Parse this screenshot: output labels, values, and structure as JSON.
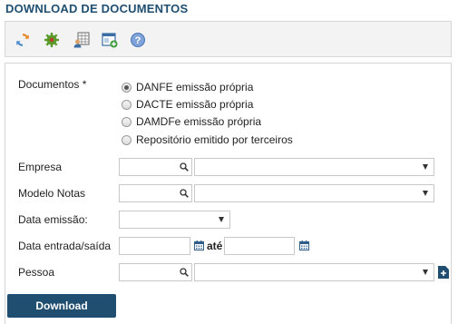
{
  "page": {
    "title": "DOWNLOAD DE DOCUMENTOS"
  },
  "toolbar": {
    "icons": [
      "refresh-icon",
      "settings-icon",
      "grid-user-icon",
      "window-add-icon",
      "help-icon"
    ]
  },
  "form": {
    "documentos": {
      "label": "Documentos *",
      "options": [
        {
          "label": "DANFE emissão própria",
          "checked": true
        },
        {
          "label": "DACTE emissão própria",
          "checked": false
        },
        {
          "label": "DAMDFe emissão própria",
          "checked": false
        },
        {
          "label": "Repositório emitido por terceiros",
          "checked": false
        }
      ]
    },
    "empresa": {
      "label": "Empresa",
      "code_value": "",
      "select_value": ""
    },
    "modelo_notas": {
      "label": "Modelo Notas",
      "code_value": "",
      "select_value": ""
    },
    "data_emissao": {
      "label": "Data emissão:",
      "select_value": ""
    },
    "data_entrada_saida": {
      "label": "Data entrada/saída",
      "from_value": "",
      "separator": "até",
      "to_value": ""
    },
    "pessoa": {
      "label": "Pessoa",
      "code_value": "",
      "select_value": ""
    }
  },
  "actions": {
    "download_label": "Download"
  },
  "colors": {
    "accent": "#1f4e70",
    "toolbar_bg": "#f3f3f3",
    "border": "#c9c9c9"
  }
}
